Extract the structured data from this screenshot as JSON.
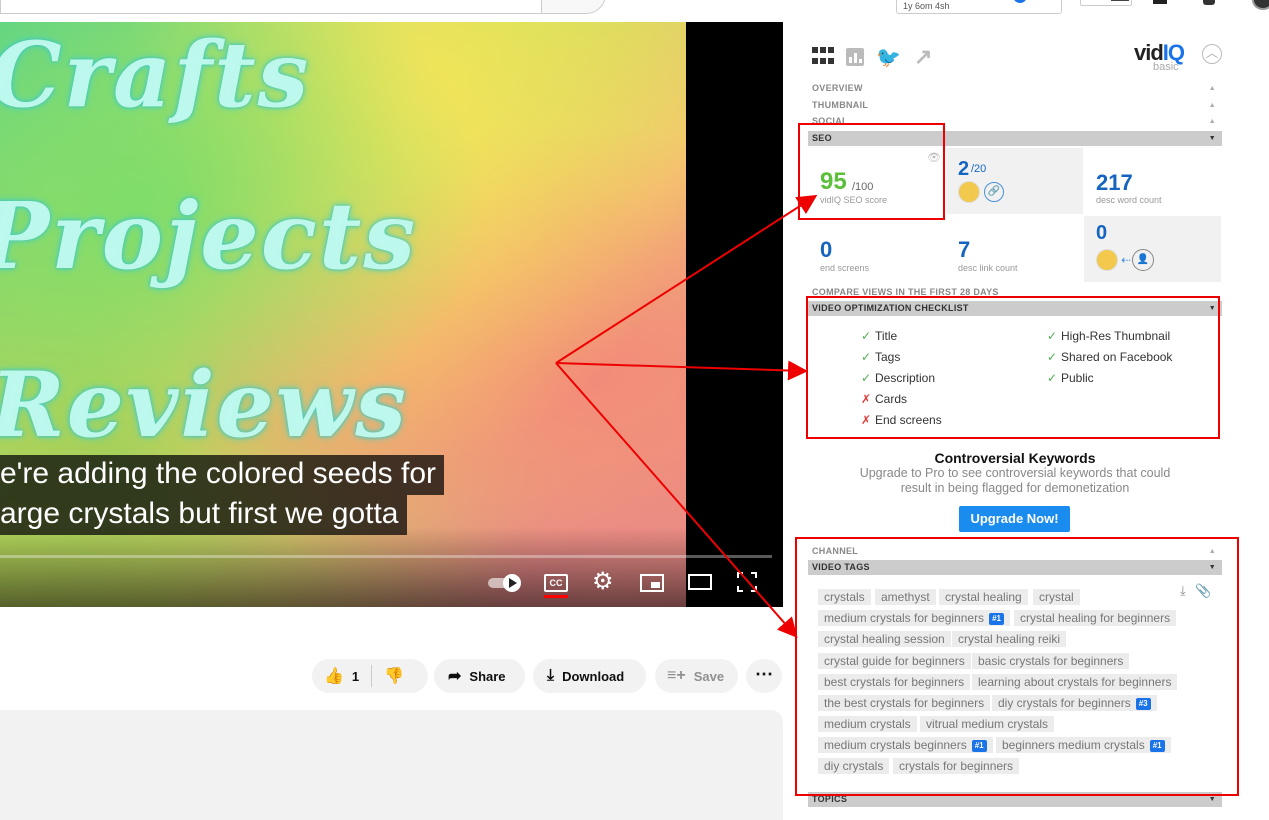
{
  "video": {
    "overlay_words": [
      "Crafts",
      "Projects",
      "Reviews"
    ],
    "captions": [
      "e're adding the colored seeds for",
      "arge crystals but first we gotta"
    ],
    "cc_label": "CC"
  },
  "actions": {
    "like_count": "1",
    "share_label": "Share",
    "download_label": "Download",
    "save_label": "Save",
    "more_label": "⋯"
  },
  "topbar": {
    "timer_text": "1y 6om 4sh"
  },
  "vidiq": {
    "logo_main": "vid",
    "logo_accent": "IQ",
    "plan": "basic",
    "sections": {
      "overview": "OVERVIEW",
      "thumbnail": "THUMBNAIL",
      "social": "SOCIAL",
      "seo": "SEO",
      "compare": "COMPARE VIEWS IN THE FIRST 28 DAYS",
      "checklist": "VIDEO OPTIMIZATION CHECKLIST",
      "channel": "CHANNEL",
      "video_tags": "VIDEO TAGS",
      "topics": "TOPICS"
    },
    "seo": {
      "score": "95",
      "score_max": "/100",
      "score_label": "vidIQ SEO score",
      "ranked_tags": "2",
      "ranked_tags_max": "/20",
      "desc_word_count": "217",
      "desc_word_count_label": "desc word count",
      "end_screens": "0",
      "end_screens_label": "end screens",
      "desc_link_count": "7",
      "desc_link_count_label": "desc link count",
      "channel_links": "0"
    },
    "checklist": {
      "left": [
        {
          "label": "Title",
          "ok": true,
          "mark": "✓"
        },
        {
          "label": "Tags",
          "ok": true,
          "mark": "✓"
        },
        {
          "label": "Description",
          "ok": true,
          "mark": "✓"
        },
        {
          "label": "Cards",
          "ok": false,
          "mark": "✗"
        },
        {
          "label": "End screens",
          "ok": false,
          "mark": "✗"
        }
      ],
      "right": [
        {
          "label": "High-Res Thumbnail",
          "ok": true,
          "mark": "✓"
        },
        {
          "label": "Shared on Facebook",
          "ok": true,
          "mark": "✓"
        },
        {
          "label": "Public",
          "ok": true,
          "mark": "✓"
        }
      ]
    },
    "controversial": {
      "title": "Controversial Keywords",
      "text": "Upgrade to Pro to see controversial keywords that could result in being flagged for demonetization",
      "button": "Upgrade Now!"
    },
    "tags": [
      {
        "label": "crystals"
      },
      {
        "label": "amethyst"
      },
      {
        "label": "crystal healing"
      },
      {
        "label": "crystal"
      },
      {
        "label": "medium crystals for beginners",
        "rank": "#1"
      },
      {
        "label": "crystal healing for beginners"
      },
      {
        "label": "crystal healing session"
      },
      {
        "label": "crystal healing reiki"
      },
      {
        "label": "crystal guide for beginners"
      },
      {
        "label": "basic crystals for beginners"
      },
      {
        "label": "best crystals for beginners"
      },
      {
        "label": "learning about crystals for beginners"
      },
      {
        "label": "the best crystals for beginners"
      },
      {
        "label": "diy crystals for beginners",
        "rank": "#3"
      },
      {
        "label": "medium crystals"
      },
      {
        "label": "vitrual medium crystals"
      },
      {
        "label": "medium crystals beginners",
        "rank": "#1"
      },
      {
        "label": "beginners medium crystals",
        "rank": "#1"
      },
      {
        "label": "diy crystals"
      },
      {
        "label": "crystals for beginners"
      }
    ]
  },
  "colors": {
    "accent_blue": "#1565c0",
    "score_green": "#5bbf3a",
    "highlight_red": "#e00000",
    "upgrade_blue": "#1a8cf0"
  }
}
